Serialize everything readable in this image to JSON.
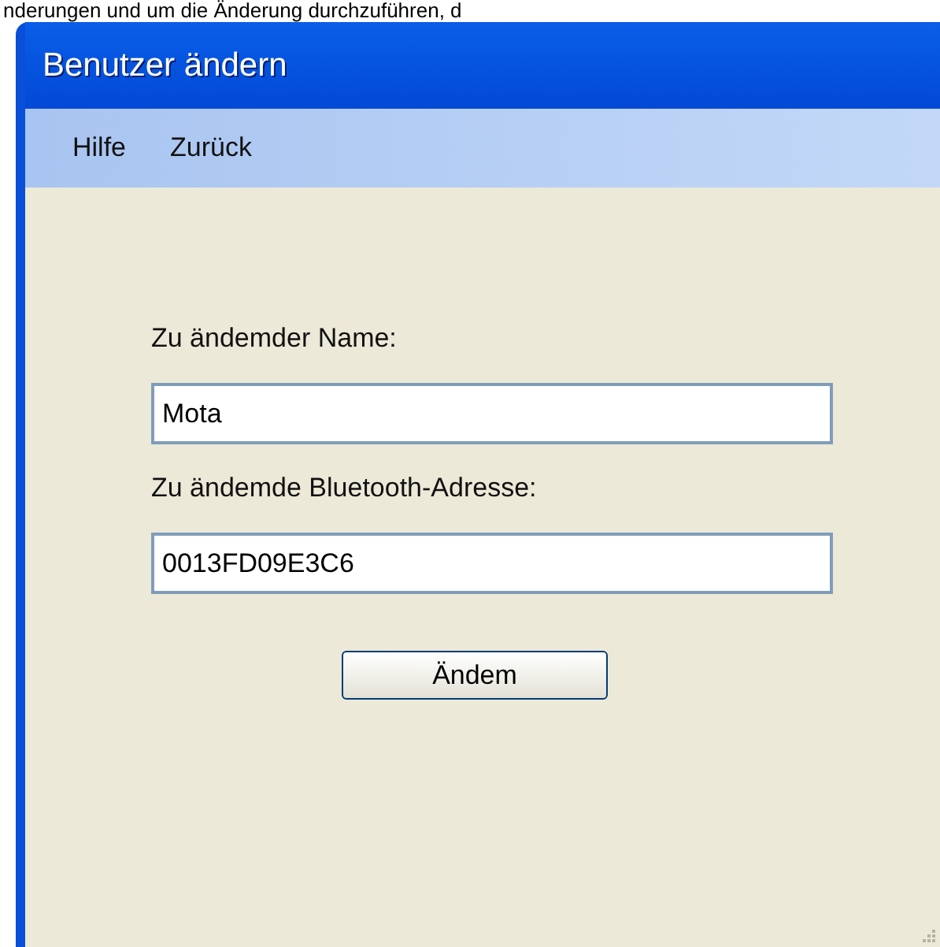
{
  "caption": "nderungen und um die Änderung durchzuführen, d",
  "window": {
    "title": "Benutzer ändern"
  },
  "menu": [
    "Hilfe",
    "Zurück"
  ],
  "form": {
    "fields": [
      {
        "label": "Zu ändemder Name:",
        "value": "Mota"
      },
      {
        "label": "Zu ändemde Bluetooth-Adresse:",
        "value": "0013FD09E3C6"
      }
    ],
    "button": "Ändem"
  }
}
